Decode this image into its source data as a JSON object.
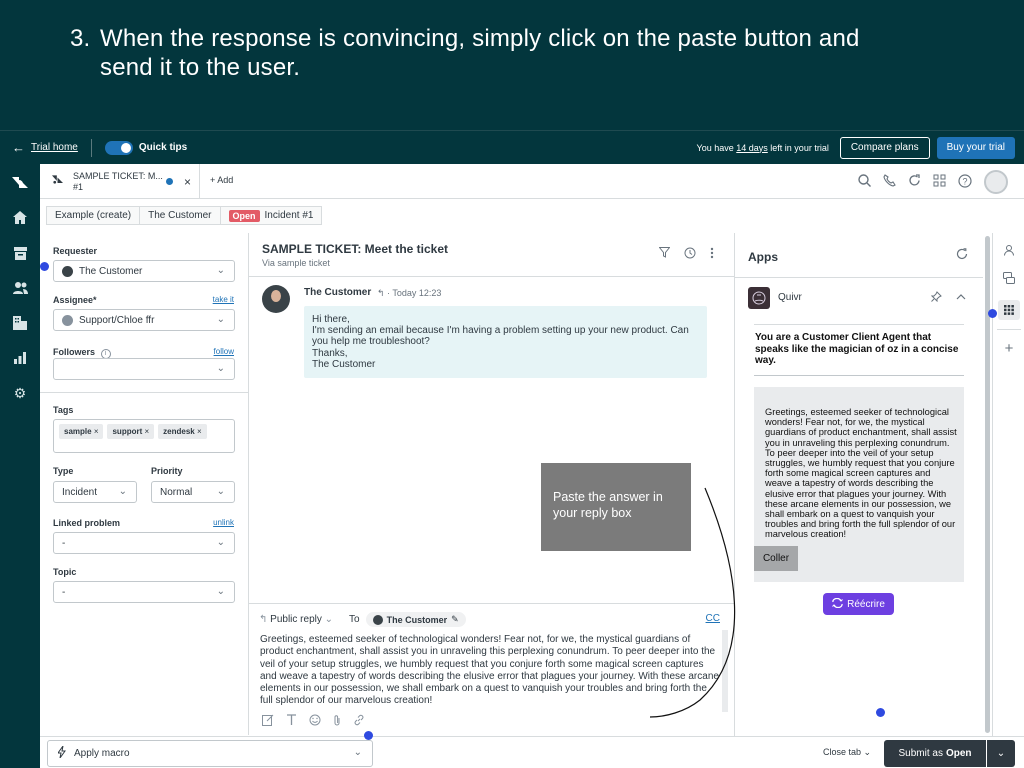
{
  "banner": {
    "step_number": "3.",
    "line1": "When the response is convincing, simply click on the paste button and",
    "line2": "send it to the user."
  },
  "trial_bar": {
    "back_icon": "arrow-left-icon",
    "trial_home": "Trial home",
    "quick_tips": "Quick tips",
    "quick_tips_on": true,
    "trial_prefix": "You have",
    "trial_days": "14 days",
    "trial_suffix": "left in your trial",
    "compare_plans": "Compare plans",
    "buy_trial": "Buy your trial"
  },
  "tab": {
    "title": "SAMPLE TICKET: M...",
    "subtitle": "#1",
    "close": "×",
    "add": "+ Add"
  },
  "breadcrumbs": {
    "item1": "Example (create)",
    "item2": "The Customer",
    "status_badge": "Open",
    "item3": "Incident #1"
  },
  "properties": {
    "requester_label": "Requester",
    "requester_value": "The Customer",
    "assignee_label": "Assignee*",
    "assignee_link": "take it",
    "assignee_value": "Support/Chloe ffr",
    "followers_label": "Followers",
    "followers_link": "follow",
    "tags_label": "Tags",
    "tags": [
      "sample",
      "support",
      "zendesk"
    ],
    "type_label": "Type",
    "type_value": "Incident",
    "priority_label": "Priority",
    "priority_value": "Normal",
    "linked_label": "Linked problem",
    "linked_link": "unlink",
    "linked_value": "-",
    "topic_label": "Topic",
    "topic_value": "-"
  },
  "ticket": {
    "title": "SAMPLE TICKET: Meet the ticket",
    "subtitle": "Via sample ticket",
    "sender": "The Customer",
    "time": "Today 12:23",
    "message": "Hi there,\nI'm sending an email because I'm having a problem setting up your new product. Can you help me troubleshoot?\nThanks,\nThe Customer"
  },
  "overlay": {
    "text": "Paste the answer in your reply box"
  },
  "reply": {
    "mode": "Public reply",
    "to_label": "To",
    "to_value": "The Customer",
    "cc": "CC",
    "body": "Greetings, esteemed seeker of technological wonders! Fear not, for we, the mystical guardians of product enchantment, shall assist you in unraveling this perplexing conundrum. To peer deeper into the veil of your setup struggles, we humbly request that you conjure forth some magical screen captures and weave a tapestry of words describing the elusive error that plagues your journey. With these arcane elements in our possession, we shall embark on a quest to vanquish your troubles and bring forth the full splendor of our marvelous creation!"
  },
  "apps": {
    "title": "Apps",
    "app_name": "Quivr",
    "prompt": "You are a Customer Client Agent that speaks like the magician of oz in a concise way.",
    "answer": "Greetings, esteemed seeker of technological wonders! Fear not, for we, the mystical guardians of product enchantment, shall assist you in unraveling this perplexing conundrum. To peer deeper into the veil of your setup struggles, we humbly request that you conjure forth some magical screen captures and weave a tapestry of words describing the elusive error that plagues your journey. With these arcane elements in our possession, we shall embark on a quest to vanquish your troubles and bring forth the full splendor of our marvelous creation!",
    "paste_button": "Coller",
    "rewrite_button": "Réécrire"
  },
  "bottom": {
    "macro": "Apply macro",
    "close_tab": "Close tab",
    "submit_prefix": "Submit as",
    "submit_status": "Open"
  },
  "colors": {
    "brand_dark": "#03363d",
    "accent_blue": "#1f73b7",
    "open_badge": "#e35b66",
    "rewrite_purple": "#6d3fe1",
    "highlight_dot": "#2f4ae0"
  }
}
